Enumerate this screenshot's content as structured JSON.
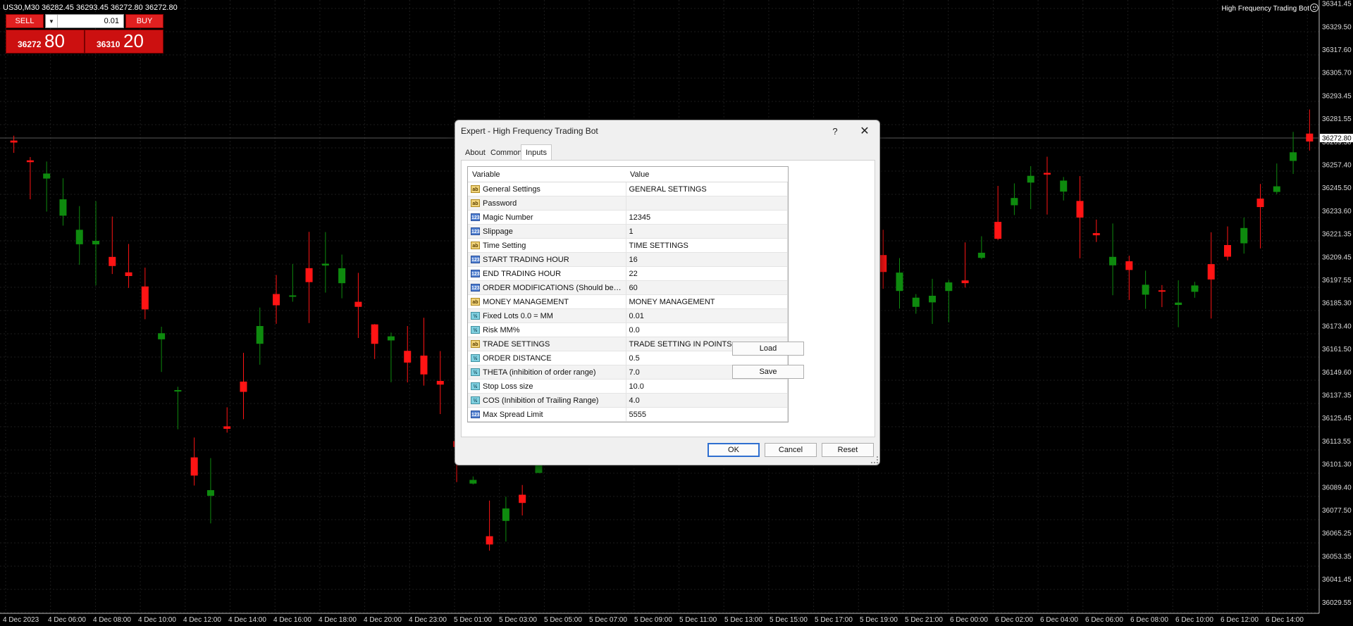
{
  "symbol_line": "US30,M30  36282.45 36293.45 36272.80 36272.80",
  "ea_name": "High Frequency Trading Bot",
  "one_click": {
    "sell_label": "SELL",
    "buy_label": "BUY",
    "lot": "0.01",
    "sell_small": "36272",
    "sell_big": "80",
    "buy_small": "36310",
    "buy_big": "20"
  },
  "price_axis": [
    "36341.45",
    "36329.50",
    "36317.60",
    "36305.70",
    "36293.45",
    "36281.55",
    "36269.30",
    "36257.40",
    "36245.50",
    "36233.60",
    "36221.35",
    "36209.45",
    "36197.55",
    "36185.30",
    "36173.40",
    "36161.50",
    "36149.60",
    "36137.35",
    "36125.45",
    "36113.55",
    "36101.30",
    "36089.40",
    "36077.50",
    "36065.25",
    "36053.35",
    "36041.45",
    "36029.55"
  ],
  "current_price_label": "36272.80",
  "time_axis": [
    "4 Dec 2023",
    "4 Dec 06:00",
    "4 Dec 08:00",
    "4 Dec 10:00",
    "4 Dec 12:00",
    "4 Dec 14:00",
    "4 Dec 16:00",
    "4 Dec 18:00",
    "4 Dec 20:00",
    "4 Dec 23:00",
    "5 Dec 01:00",
    "5 Dec 03:00",
    "5 Dec 05:00",
    "5 Dec 07:00",
    "5 Dec 09:00",
    "5 Dec 11:00",
    "5 Dec 13:00",
    "5 Dec 15:00",
    "5 Dec 17:00",
    "5 Dec 19:00",
    "5 Dec 21:00",
    "6 Dec 00:00",
    "6 Dec 02:00",
    "6 Dec 04:00",
    "6 Dec 06:00",
    "6 Dec 08:00",
    "6 Dec 10:00",
    "6 Dec 12:00",
    "6 Dec 14:00"
  ],
  "colors": {
    "bull": "#0e8a0e",
    "bear": "#ff1414",
    "grid": "#1c1c1c",
    "current_line": "#5a5a5a"
  },
  "dialog": {
    "title": "Expert - High Frequency Trading Bot",
    "help": "?",
    "close": "✕",
    "tabs": [
      "About",
      "Common",
      "Inputs"
    ],
    "active_tab": "Inputs",
    "col_variable": "Variable",
    "col_value": "Value",
    "rows": [
      {
        "type": "ab",
        "icon": "string-icon",
        "name": "General Settings",
        "value": "GENERAL SETTINGS"
      },
      {
        "type": "ab",
        "icon": "string-icon",
        "name": "Password",
        "value": ""
      },
      {
        "type": "123",
        "icon": "integer-icon",
        "name": "Magic Number",
        "value": "12345"
      },
      {
        "type": "123",
        "icon": "integer-icon",
        "name": "Slippage",
        "value": "1"
      },
      {
        "type": "ab",
        "icon": "string-icon",
        "name": "Time Setting",
        "value": "TIME SETTINGS"
      },
      {
        "type": "123",
        "icon": "integer-icon",
        "name": "START TRADING HOUR",
        "value": "16"
      },
      {
        "type": "123",
        "icon": "integer-icon",
        "name": "END TRADING HOUR",
        "value": "22"
      },
      {
        "type": "123",
        "icon": "integer-icon",
        "name": "ORDER MODIFICATIONS (Should be s...",
        "value": "60"
      },
      {
        "type": "ab",
        "icon": "string-icon",
        "name": "MONEY MANAGEMENT",
        "value": "MONEY MANAGEMENT"
      },
      {
        "type": "½",
        "icon": "double-icon",
        "name": "Fixed Lots 0.0 = MM",
        "value": "0.01"
      },
      {
        "type": "½",
        "icon": "double-icon",
        "name": "Risk MM%",
        "value": "0.0"
      },
      {
        "type": "ab",
        "icon": "string-icon",
        "name": "TRADE SETTINGS",
        "value": "TRADE SETTING IN POINTS"
      },
      {
        "type": "½",
        "icon": "double-icon",
        "name": "ORDER DISTANCE",
        "value": "0.5"
      },
      {
        "type": "½",
        "icon": "double-icon",
        "name": "THETA (inhibition of order range)",
        "value": "7.0"
      },
      {
        "type": "½",
        "icon": "double-icon",
        "name": "Stop Loss size",
        "value": "10.0"
      },
      {
        "type": "½",
        "icon": "double-icon",
        "name": "COS (Inhibition of Trailing Range)",
        "value": "4.0"
      },
      {
        "type": "123",
        "icon": "integer-icon",
        "name": "Max Spread Limit",
        "value": "5555"
      }
    ],
    "load_label": "Load",
    "save_label": "Save",
    "ok_label": "OK",
    "cancel_label": "Cancel",
    "reset_label": "Reset"
  }
}
